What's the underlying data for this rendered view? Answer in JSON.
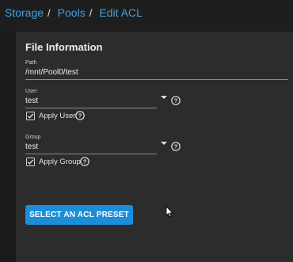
{
  "breadcrumb": {
    "items": [
      "Storage",
      "Pools",
      "Edit ACL"
    ],
    "separator": "/"
  },
  "card": {
    "title": "File Information",
    "path": {
      "label": "Path",
      "value": "/mnt/Pool0/test"
    },
    "user": {
      "label": "User",
      "value": "test",
      "apply_label": "Apply User",
      "apply_checked": true
    },
    "group": {
      "label": "Group",
      "value": "test",
      "apply_label": "Apply Group",
      "apply_checked": true
    },
    "preset_button_label": "SELECT AN ACL PRESET"
  },
  "colors": {
    "accent": "#1a8ed8",
    "link": "#3da1e0",
    "background": "#1e1e1e",
    "card": "#2c2c2c"
  },
  "icons": [
    "help-circle-icon",
    "dropdown-caret-icon",
    "checkbox-checked-icon",
    "mouse-pointer-icon"
  ]
}
